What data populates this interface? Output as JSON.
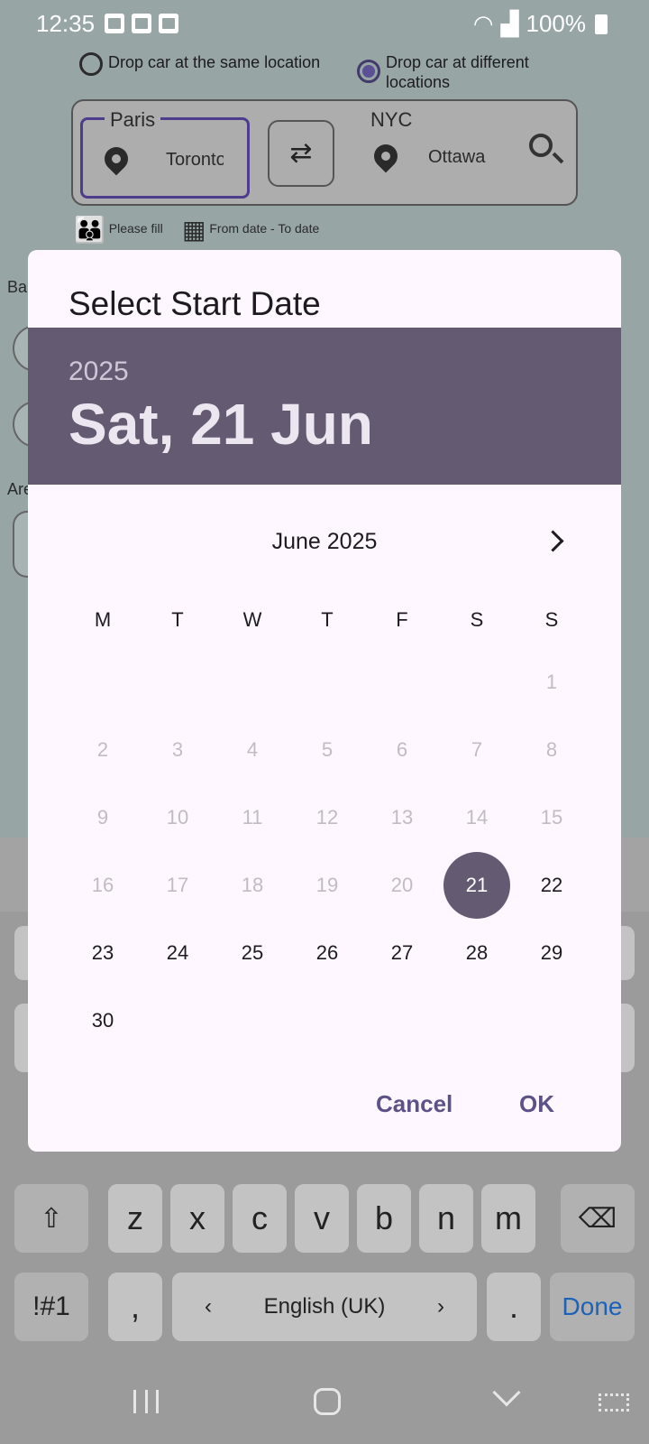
{
  "status_bar": {
    "time": "12:35",
    "battery": "100%"
  },
  "background": {
    "radio_same": "Drop car at the same location",
    "radio_different": "Drop car at different locations",
    "from_label": "Paris",
    "from_value": "Toronto",
    "to_label": "NYC",
    "to_value": "Ottawa",
    "hint_people": "Please fill",
    "hint_date": "From date - To date",
    "side_ba": "Ba",
    "side_are": "Are"
  },
  "dialog": {
    "title": "Select Start Date",
    "year": "2025",
    "selected_date": "Sat, 21 Jun",
    "month": "June 2025",
    "weekdays": [
      "M",
      "T",
      "W",
      "T",
      "F",
      "S",
      "S"
    ],
    "days": [
      {
        "label": "1",
        "state": "disabled",
        "col": 6,
        "row": 0
      },
      {
        "label": "2",
        "state": "disabled",
        "col": 0,
        "row": 1
      },
      {
        "label": "3",
        "state": "disabled",
        "col": 1,
        "row": 1
      },
      {
        "label": "4",
        "state": "disabled",
        "col": 2,
        "row": 1
      },
      {
        "label": "5",
        "state": "disabled",
        "col": 3,
        "row": 1
      },
      {
        "label": "6",
        "state": "disabled",
        "col": 4,
        "row": 1
      },
      {
        "label": "7",
        "state": "disabled",
        "col": 5,
        "row": 1
      },
      {
        "label": "8",
        "state": "disabled",
        "col": 6,
        "row": 1
      },
      {
        "label": "9",
        "state": "disabled",
        "col": 0,
        "row": 2
      },
      {
        "label": "10",
        "state": "disabled",
        "col": 1,
        "row": 2
      },
      {
        "label": "11",
        "state": "disabled",
        "col": 2,
        "row": 2
      },
      {
        "label": "12",
        "state": "disabled",
        "col": 3,
        "row": 2
      },
      {
        "label": "13",
        "state": "disabled",
        "col": 4,
        "row": 2
      },
      {
        "label": "14",
        "state": "disabled",
        "col": 5,
        "row": 2
      },
      {
        "label": "15",
        "state": "disabled",
        "col": 6,
        "row": 2
      },
      {
        "label": "16",
        "state": "disabled",
        "col": 0,
        "row": 3
      },
      {
        "label": "17",
        "state": "disabled",
        "col": 1,
        "row": 3
      },
      {
        "label": "18",
        "state": "disabled",
        "col": 2,
        "row": 3
      },
      {
        "label": "19",
        "state": "disabled",
        "col": 3,
        "row": 3
      },
      {
        "label": "20",
        "state": "disabled",
        "col": 4,
        "row": 3
      },
      {
        "label": "21",
        "state": "selected",
        "col": 5,
        "row": 3
      },
      {
        "label": "22",
        "state": "enabled",
        "col": 6,
        "row": 3
      },
      {
        "label": "23",
        "state": "enabled",
        "col": 0,
        "row": 4
      },
      {
        "label": "24",
        "state": "enabled",
        "col": 1,
        "row": 4
      },
      {
        "label": "25",
        "state": "enabled",
        "col": 2,
        "row": 4
      },
      {
        "label": "26",
        "state": "enabled",
        "col": 3,
        "row": 4
      },
      {
        "label": "27",
        "state": "enabled",
        "col": 4,
        "row": 4
      },
      {
        "label": "28",
        "state": "enabled",
        "col": 5,
        "row": 4
      },
      {
        "label": "29",
        "state": "enabled",
        "col": 6,
        "row": 4
      },
      {
        "label": "30",
        "state": "enabled",
        "col": 0,
        "row": 5
      }
    ],
    "cancel": "Cancel",
    "ok": "OK"
  },
  "keyboard": {
    "row3": [
      "z",
      "x",
      "c",
      "v",
      "b",
      "n",
      "m"
    ],
    "symbols": "!#1",
    "comma": ",",
    "language": "English (UK)",
    "period": ".",
    "done": "Done"
  },
  "colors": {
    "dialog_bg": "#fef7ff",
    "header_bg": "#645b73",
    "accent": "#5d5288",
    "done_blue": "#1d62b7"
  }
}
